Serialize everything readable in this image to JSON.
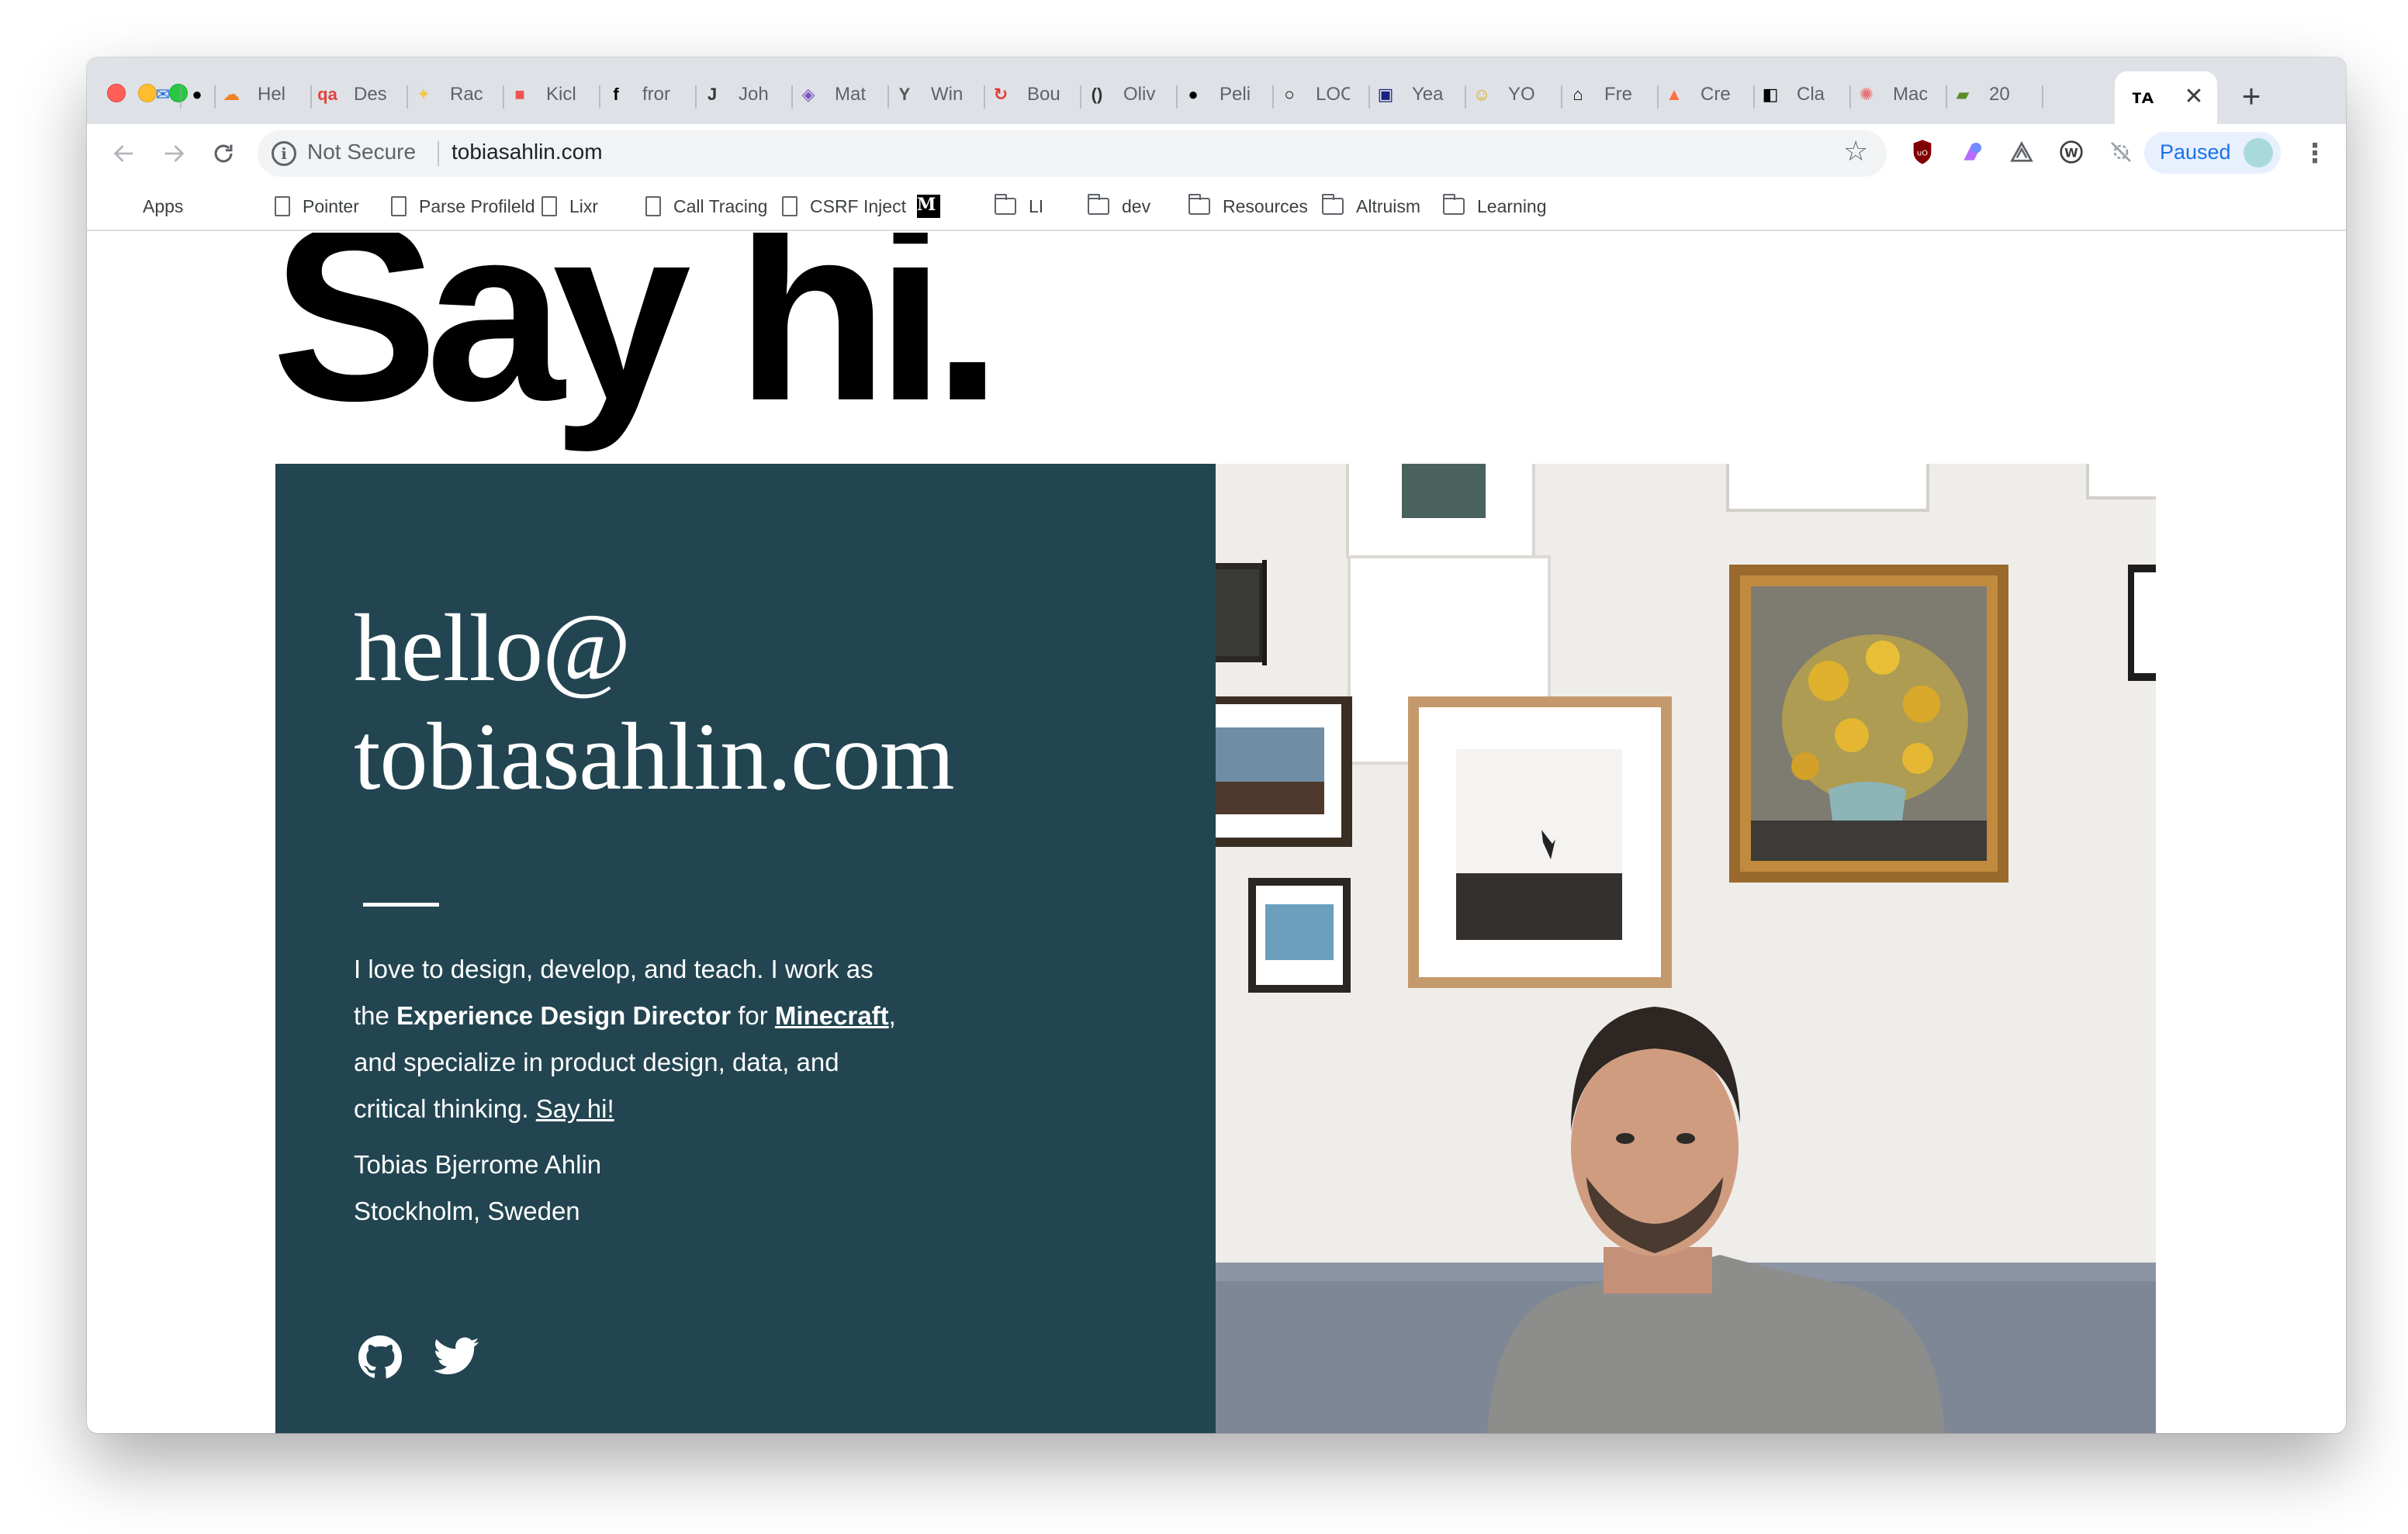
{
  "browser": {
    "tabs": [
      {
        "label": "",
        "icon": "inbox-icon"
      },
      {
        "label": "",
        "icon": "github-icon"
      },
      {
        "label": "Hel",
        "icon": "cloudflare-icon"
      },
      {
        "label": "Des",
        "icon": "qa-icon"
      },
      {
        "label": "Rac",
        "icon": "sparkle-icon"
      },
      {
        "label": "Kicl",
        "icon": "red-square-icon"
      },
      {
        "label": "fror",
        "icon": "function-icon"
      },
      {
        "label": "Joh",
        "icon": "j-icon"
      },
      {
        "label": "Mat",
        "icon": "chart-icon"
      },
      {
        "label": "Win",
        "icon": "y-icon"
      },
      {
        "label": "Bou",
        "icon": "refresh-red-icon"
      },
      {
        "label": "Oliv",
        "icon": "parens-icon"
      },
      {
        "label": "Peli",
        "icon": "black-dot-icon"
      },
      {
        "label": "LOC",
        "icon": "ring-icon"
      },
      {
        "label": "Yea",
        "icon": "td-icon"
      },
      {
        "label": "YO",
        "icon": "smiley-icon"
      },
      {
        "label": "Fre",
        "icon": "house-icon"
      },
      {
        "label": "Cre",
        "icon": "prism-icon"
      },
      {
        "label": "Cla",
        "icon": "half-square-icon"
      },
      {
        "label": "Mac",
        "icon": "pinwheel-icon"
      },
      {
        "label": "20",
        "icon": "shopify-icon"
      }
    ],
    "active_tab_icon": "ta-logo-icon",
    "close_glyph": "✕",
    "new_tab_glyph": "+",
    "security_label": "Not Secure",
    "url": "tobiasahlin.com",
    "profile_label": "Paused",
    "bookmarks": [
      {
        "label": "Apps",
        "icon": "apps-grid-icon"
      },
      {
        "label": "Pointer",
        "icon": "page-icon"
      },
      {
        "label": "Parse Profileld",
        "icon": "page-icon"
      },
      {
        "label": "Lixr",
        "icon": "page-icon"
      },
      {
        "label": "Call Tracing",
        "icon": "page-icon"
      },
      {
        "label": "CSRF Inject",
        "icon": "page-icon"
      },
      {
        "label": "",
        "icon": "medium-icon"
      },
      {
        "label": "LI",
        "icon": "folder-icon"
      },
      {
        "label": "dev",
        "icon": "folder-icon"
      },
      {
        "label": "Resources",
        "icon": "folder-icon"
      },
      {
        "label": "Altruism",
        "icon": "folder-icon"
      },
      {
        "label": "Learning",
        "icon": "folder-icon"
      }
    ]
  },
  "page": {
    "hero": "Say hi.",
    "email_line1": "hello@",
    "email_line2": "tobiasahlin.com",
    "bio_part1": "I love to design, develop, and teach. I work as the ",
    "bio_bold": "Experience Design Director",
    "bio_part2": " for ",
    "bio_link": "Minecraft",
    "bio_part3": ", and specialize in product design, data, and critical thinking. ",
    "bio_link2": "Say hi!",
    "name": "Tobias Bjerrome Ahlin",
    "location": "Stockholm, Sweden",
    "social": [
      "github-icon",
      "twitter-icon"
    ],
    "card_color": "#224551"
  }
}
